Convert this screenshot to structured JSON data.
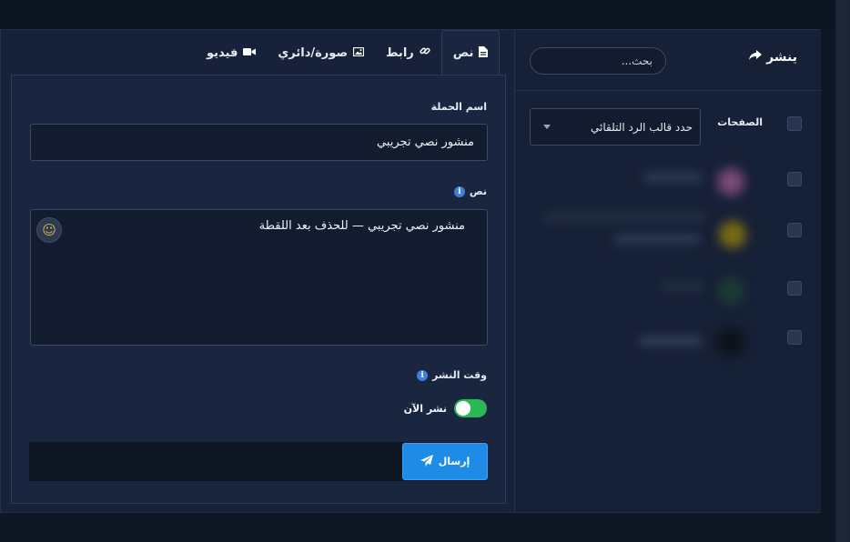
{
  "publish": {
    "title": "ينشر",
    "icon": "share-arrow-icon"
  },
  "search": {
    "placeholder": "بحث..."
  },
  "pages": {
    "label": "الصفحات",
    "template_select": {
      "value": "حدد قالب الرد التلقائي"
    }
  },
  "tabs": [
    {
      "label": "نص",
      "icon": "document-icon",
      "active": true
    },
    {
      "label": "رابط",
      "icon": "link-icon",
      "active": false
    },
    {
      "label": "صورة/دائري",
      "icon": "image-icon",
      "active": false
    },
    {
      "label": "فيديو",
      "icon": "video-camera-icon",
      "active": false
    }
  ],
  "form": {
    "campaign_name_label": "اسم الحملة",
    "campaign_name_value": "منشور نصي تجريبي",
    "text_label": "نص",
    "text_value": "منشور نصي تجريبي — للحذف بعد اللقطة",
    "publish_time_label": "وقت النشر",
    "publish_now_label": "نشر الآن",
    "publish_now_on": true,
    "send_label": "إرسال"
  },
  "colors": {
    "accent": "#1e8ce6",
    "toggle_on": "#2bb756",
    "info": "#3d7ee0",
    "background": "#17223a"
  }
}
